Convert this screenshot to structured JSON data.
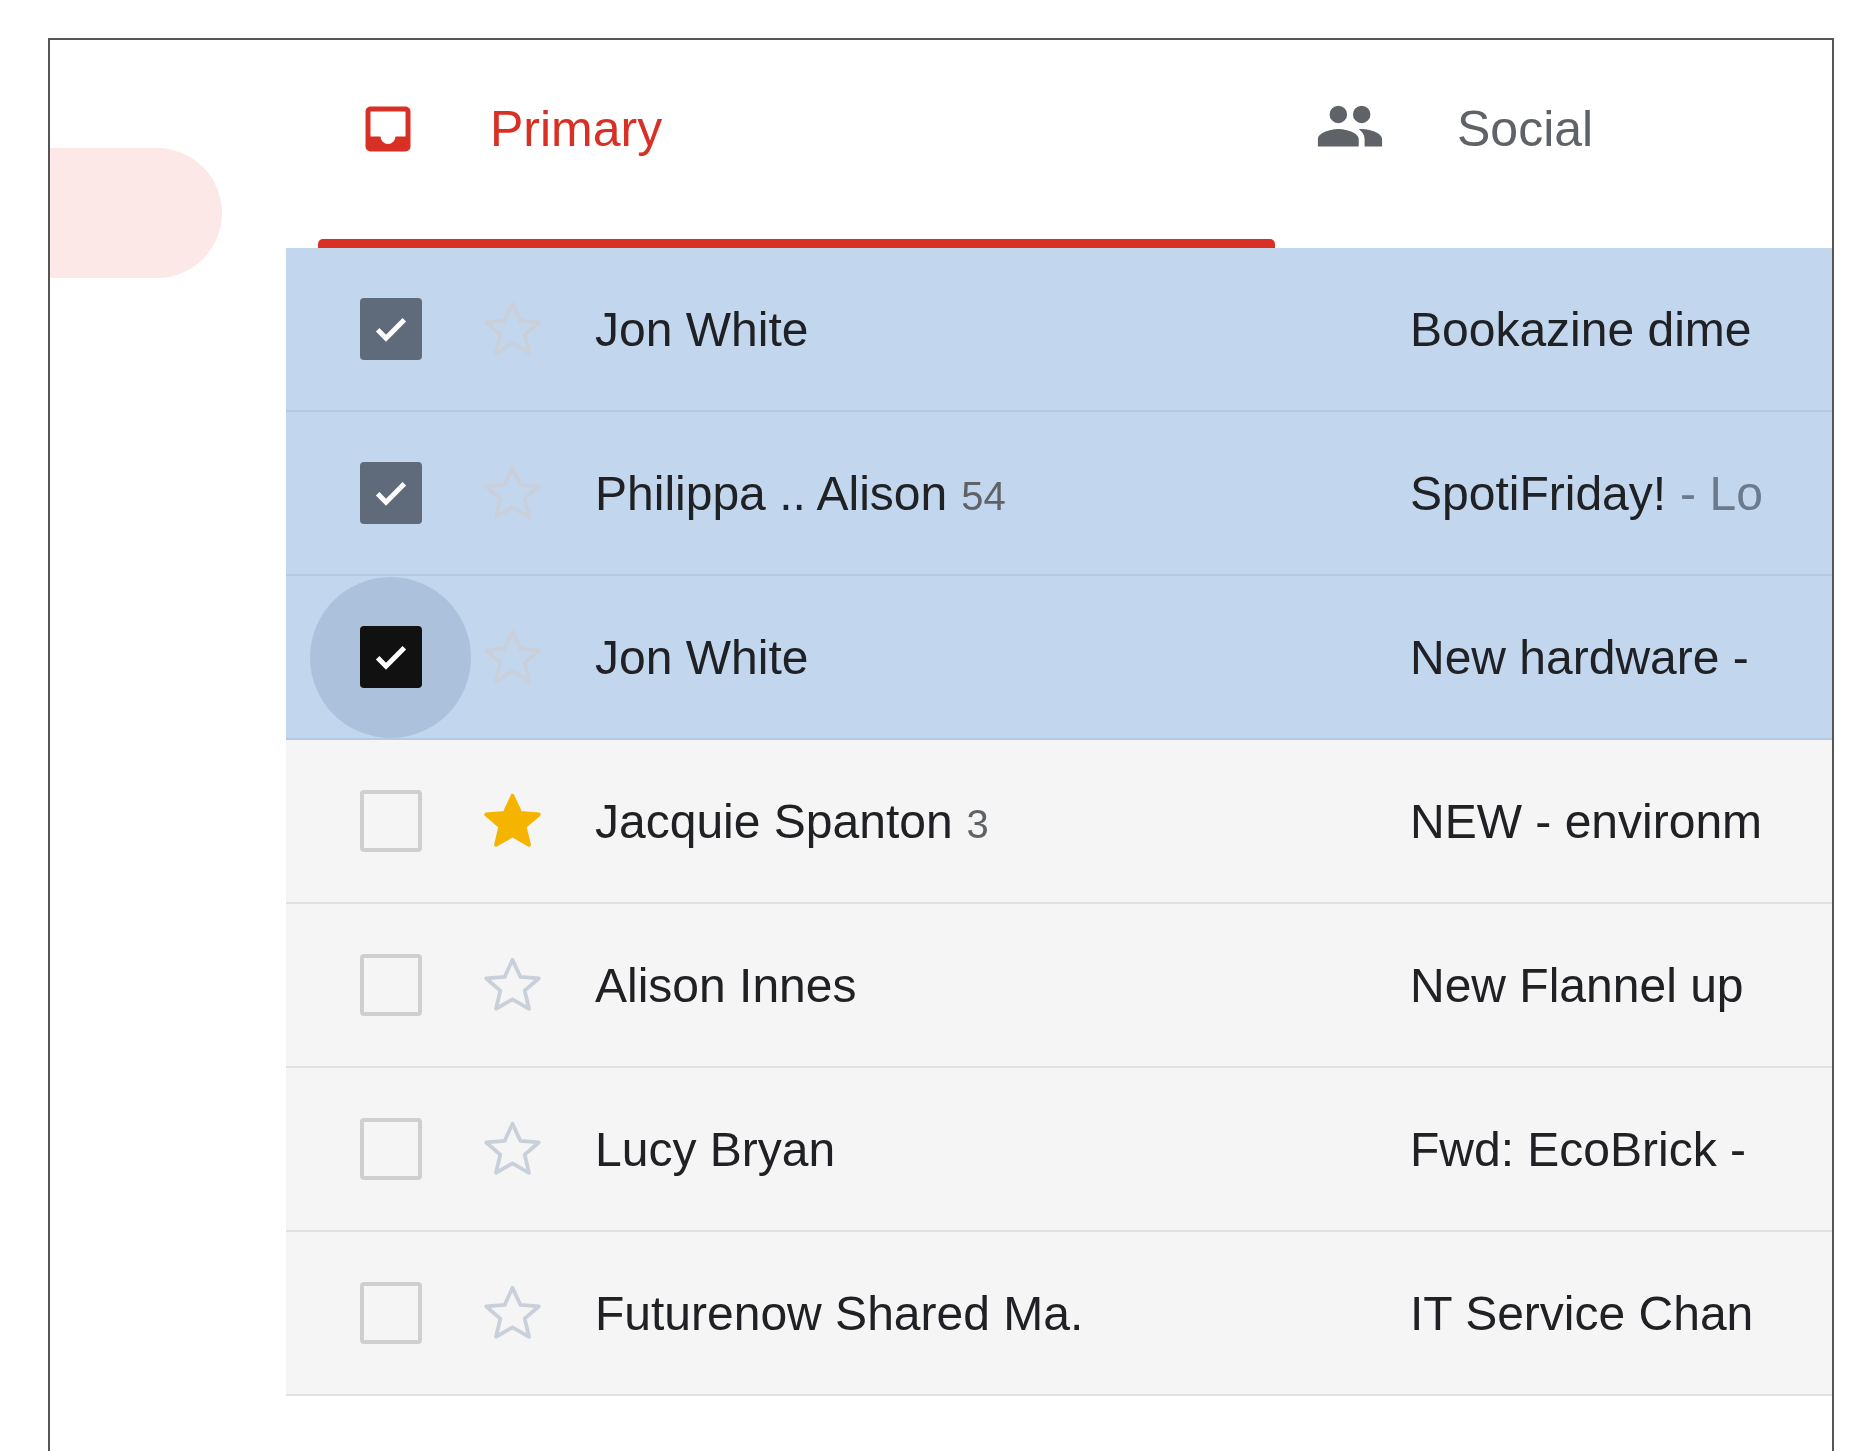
{
  "sidebar": {
    "active_item": {
      "selected": true
    }
  },
  "tabs": [
    {
      "kind": "inbox",
      "label": "Primary",
      "selected": true
    },
    {
      "kind": "people",
      "label": "Social",
      "selected": false
    }
  ],
  "rows": [
    {
      "sender": "Jon White",
      "subject": "Bookazine dime",
      "selected": true,
      "starred": false,
      "focused": false
    },
    {
      "sender": "Philippa .. Alison",
      "count": "54",
      "subject": "SpotiFriday!",
      "snippet": "- Lo",
      "selected": true,
      "starred": false,
      "focused": false
    },
    {
      "sender": "Jon White",
      "subject": "New hardware -",
      "selected": true,
      "starred": false,
      "focused": true
    },
    {
      "sender": "Jacquie Spanton",
      "count": "3",
      "subject": "NEW - environm",
      "selected": false,
      "starred": true,
      "focused": false
    },
    {
      "sender": "Alison Innes",
      "subject": "New Flannel up",
      "selected": false,
      "starred": false,
      "focused": false
    },
    {
      "sender": "Lucy Bryan",
      "subject": "Fwd: EcoBrick -",
      "selected": false,
      "starred": false,
      "focused": false
    },
    {
      "sender": "Futurenow Shared Ma.",
      "subject": "IT Service Chan",
      "selected": false,
      "starred": false,
      "focused": false
    }
  ]
}
